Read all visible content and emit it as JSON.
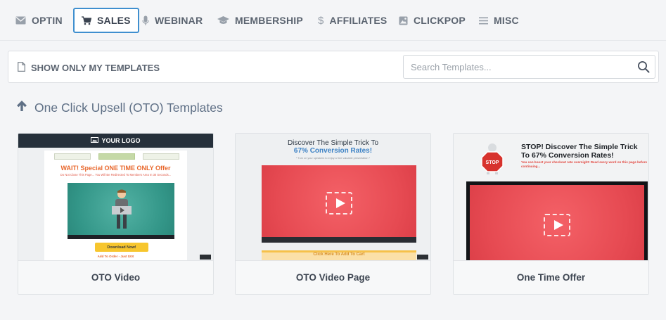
{
  "nav": {
    "tabs": [
      {
        "label": "OPTIN",
        "icon": "envelope-icon"
      },
      {
        "label": "SALES",
        "icon": "cart-icon",
        "active": true
      },
      {
        "label": "WEBINAR",
        "icon": "microphone-icon"
      },
      {
        "label": "MEMBERSHIP",
        "icon": "graduation-cap-icon"
      },
      {
        "label": "AFFILIATES",
        "icon": "dollar-icon"
      },
      {
        "label": "CLICKPOP",
        "icon": "image-icon"
      },
      {
        "label": "MISC",
        "icon": "list-icon"
      }
    ]
  },
  "filter": {
    "only_mine_label": "SHOW ONLY MY TEMPLATES",
    "search_placeholder": "Search Templates..."
  },
  "section": {
    "title": "One Click Upsell (OTO) Templates"
  },
  "cards": [
    {
      "caption": "OTO Video",
      "thumb": {
        "logo": "YOUR LOGO",
        "headline": "WAIT! Special ONE TIME ONLY Offer",
        "sub": "Do Not Close This Page... You Will Be Redirected To Members Area In 30 Seconds...",
        "button": "Download Now!",
        "add": "Add To Order - Just $XX"
      }
    },
    {
      "caption": "OTO Video Page",
      "thumb": {
        "headline_1": "Discover The Simple Trick To",
        "headline_2": "67% Conversion Rates!",
        "small": "* Turn on your speakers to enjoy a free valuable presentation *",
        "cta": "Click Here To Add To Cart"
      }
    },
    {
      "caption": "One Time Offer",
      "thumb": {
        "stop": "STOP",
        "headline": "STOP! Discover The Simple Trick To 67% Conversion Rates!",
        "sub": "You can boost your checkout rate overnight! Read every word on this page before continuing..."
      }
    }
  ],
  "colors": {
    "accent": "#3f8fcf",
    "oto_teal": "#339688",
    "video_red": "#e64a52",
    "headline_blue": "#3d82c5"
  }
}
